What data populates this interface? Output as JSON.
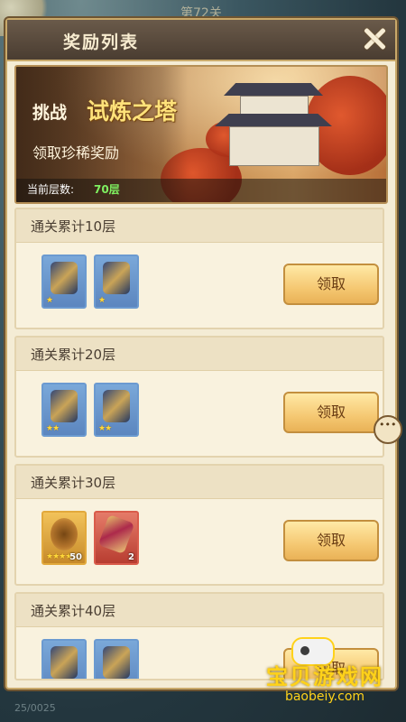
{
  "background": {
    "level_text": "第72关",
    "bottom_text": "25/0025"
  },
  "panel": {
    "title": "奖励列表",
    "close_icon": "close-icon"
  },
  "banner": {
    "challenge_label": "挑战",
    "tower_name": "试炼之塔",
    "subtitle": "领取珍稀奖励",
    "floor_label": "当前层数:",
    "floor_value": "70层"
  },
  "rewards": [
    {
      "title": "通关累计10层",
      "button_label": "领取",
      "items": [
        {
          "icon": "armor-item-icon",
          "style": "blue",
          "stars": "★",
          "count": ""
        },
        {
          "icon": "robe-item-icon",
          "style": "blue",
          "stars": "★",
          "count": ""
        }
      ]
    },
    {
      "title": "通关累计20层",
      "button_label": "领取",
      "items": [
        {
          "icon": "bracer-item-icon",
          "style": "blue",
          "stars": "★★",
          "count": ""
        },
        {
          "icon": "helmet-item-icon",
          "style": "blue",
          "stars": "★★",
          "count": ""
        }
      ]
    },
    {
      "title": "通关累计30层",
      "button_label": "领取",
      "items": [
        {
          "icon": "spirit-orb-item-icon",
          "style": "gold",
          "stars": "★★★★",
          "count": "50"
        },
        {
          "icon": "charm-item-icon",
          "style": "red",
          "stars": "",
          "count": "2"
        }
      ]
    },
    {
      "title": "通关累计40层",
      "button_label": "领取",
      "items": [
        {
          "icon": "bracer-item-icon",
          "style": "blue",
          "stars": "",
          "count": ""
        },
        {
          "icon": "armor-item-icon",
          "style": "blue",
          "stars": "",
          "count": ""
        }
      ]
    }
  ],
  "chat": {
    "icon": "chat-bubble-icon"
  },
  "watermark": {
    "title": "宝贝游戏网",
    "url": "baobeiy.com"
  }
}
